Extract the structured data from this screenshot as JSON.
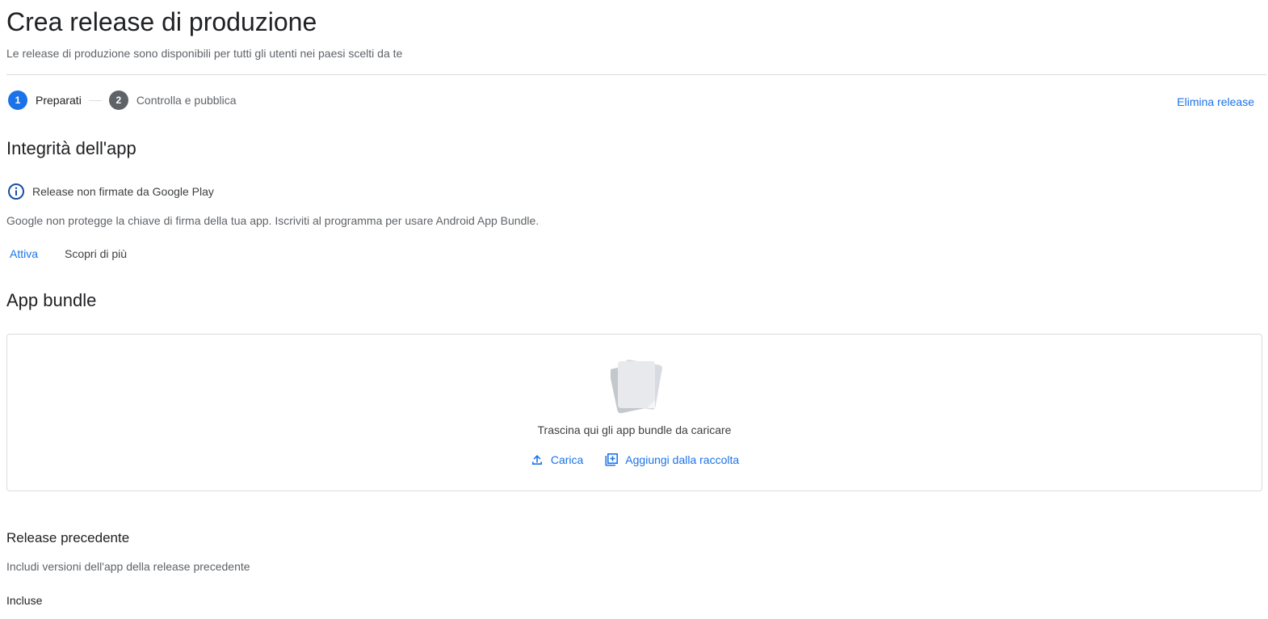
{
  "header": {
    "title": "Crea release di produzione",
    "subtitle": "Le release di produzione sono disponibili per tutti gli utenti nei paesi scelti da te"
  },
  "stepper": {
    "steps": [
      {
        "number": "1",
        "label": "Preparati",
        "state": "active"
      },
      {
        "number": "2",
        "label": "Controlla e pubblica",
        "state": "inactive"
      }
    ]
  },
  "actions": {
    "delete_release": "Elimina release"
  },
  "integrity": {
    "title": "Integrità dell'app",
    "info_icon": "info-circle-icon",
    "info_text": "Release non firmate da Google Play",
    "description": "Google non protegge la chiave di firma della tua app. Iscriviti al programma per usare Android App Bundle.",
    "activate_label": "Attiva",
    "learn_more_label": "Scopri di più"
  },
  "bundle": {
    "title": "App bundle",
    "illustration_icon": "stacked-documents-icon",
    "drop_text": "Trascina qui gli app bundle da caricare",
    "upload_icon": "upload-icon",
    "upload_label": "Carica",
    "library_icon": "add-to-library-icon",
    "library_label": "Aggiungi dalla raccolta"
  },
  "previous_release": {
    "title": "Release precedente",
    "description": "Includi versioni dell'app della release precedente",
    "included_label": "Incluse"
  },
  "colors": {
    "accent": "#1a73e8",
    "text_primary": "#202124",
    "text_secondary": "#5f6368",
    "border": "#dadce0",
    "step_inactive": "#5f6368"
  }
}
